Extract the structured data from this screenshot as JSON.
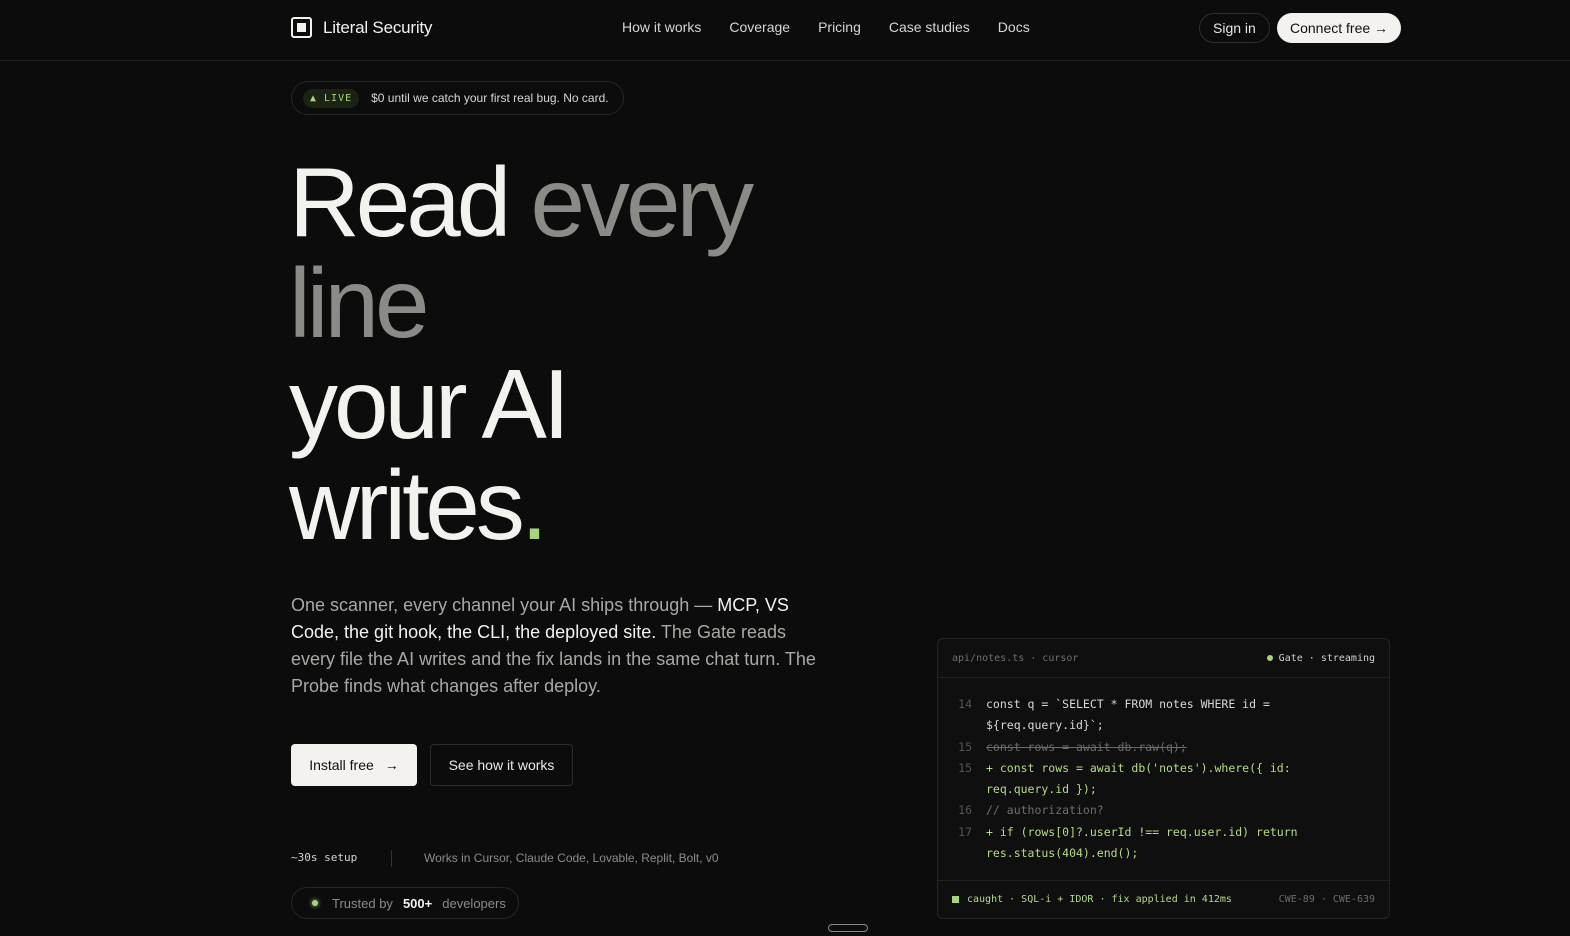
{
  "brand": {
    "name": "Literal Security"
  },
  "nav": {
    "links": [
      "How it works",
      "Coverage",
      "Pricing",
      "Case studies",
      "Docs"
    ],
    "signin": "Sign in",
    "connect": "Connect free →"
  },
  "live": {
    "tag": "▲ LIVE",
    "text": "$0 until we catch your first real bug. No card."
  },
  "headline": {
    "w1": "Read ",
    "g1": "every",
    "g2": "line",
    "w2": "your AI",
    "w3": "writes",
    "dot": "."
  },
  "lead": {
    "p1": "One scanner, every channel your AI ships through — ",
    "h1": "MCP, VS Code, the git hook, the CLI, the deployed site.",
    "p2": " The Gate reads every file the AI writes and the fix lands in the same chat turn. The Probe finds what changes after deploy."
  },
  "cta": {
    "primary": "Install free",
    "primary_arrow": "→",
    "secondary": "See how it works"
  },
  "setup": {
    "label": "~30s setup",
    "works": "Works in Cursor, Claude Code, Lovable, Replit, Bolt, v0"
  },
  "trusted": {
    "prefix": "Trusted by",
    "count": "500+",
    "suffix": "developers"
  },
  "panel": {
    "file": "api/notes.ts · cursor",
    "status": "Gate · streaming",
    "lines": [
      {
        "n": "14",
        "t": "const q = `SELECT * FROM notes WHERE id =",
        "k": "plain"
      },
      {
        "n": "",
        "t": "${req.query.id}`;",
        "k": "plain"
      },
      {
        "n": "15",
        "t": "const rows = await db.raw(q);",
        "k": "del"
      },
      {
        "n": "15",
        "t": "+ const rows = await db('notes').where({ id:",
        "k": "add"
      },
      {
        "n": "",
        "t": "req.query.id });",
        "k": "add"
      },
      {
        "n": "16",
        "t": "// authorization?",
        "k": "cmt"
      },
      {
        "n": "17",
        "t": "+ if (rows[0]?.userId !== req.user.id) return",
        "k": "add"
      },
      {
        "n": "",
        "t": "res.status(404).end();",
        "k": "add"
      }
    ],
    "foot_left": "caught · SQL-i + IDOR · fix applied in 412ms",
    "foot_right": "CWE-89 · CWE-639"
  }
}
